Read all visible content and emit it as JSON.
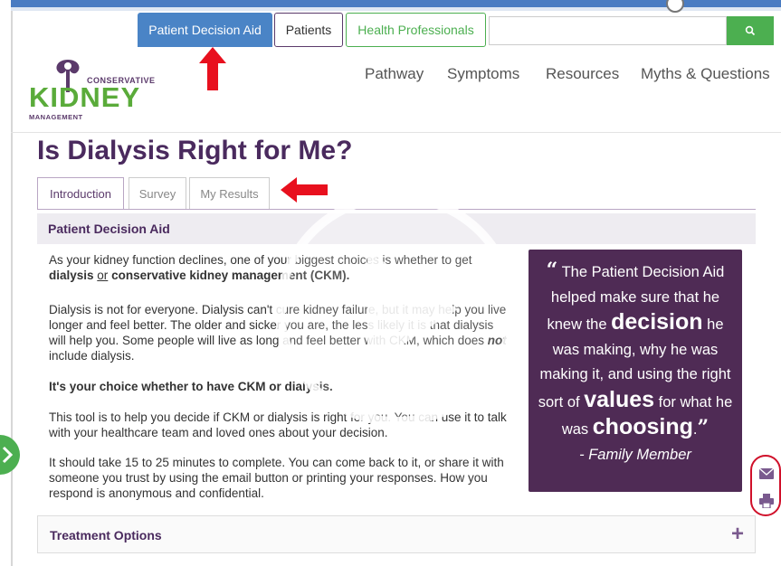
{
  "top_nav": {
    "patient_decision_aid": "Patient Decision Aid",
    "patients": "Patients",
    "health_professionals": "Health Professionals",
    "search_placeholder": ""
  },
  "logo": {
    "line1": "CONSERVATIVE",
    "kidney": "KIDNEY",
    "line3": "MANAGEMENT"
  },
  "main_nav": [
    "Pathway",
    "Symptoms",
    "Resources",
    "Myths & Questions"
  ],
  "page": {
    "title": "Is Dialysis Right for Me?",
    "tabs": [
      "Introduction",
      "Survey",
      "My Results"
    ],
    "section_heading": "Patient Decision Aid",
    "para1_a": "As your kidney function declines, one of your biggest choices is whether to get ",
    "para1_b": "dialysis",
    "para1_c": "or",
    "para1_d": "conservative kidney management (CKM).",
    "para2_a": "Dialysis is not for everyone. Dialysis can't cure kidney failure, but it may help you live longer and feel better. The older and sicker you are, the less likely it is that dialysis will help you. Some people will live as long and feel better with CKM, which does ",
    "para2_b": "not",
    "para2_c": " include dialysis.",
    "para3": "It's your choice whether to have CKM or dialysis.",
    "para4": "This tool is to help you decide if CKM or dialysis is right for you. You can use it to talk with your healthcare team and loved ones about your decision.",
    "para5": "It should take 15 to 25 minutes to complete.  You can come back to it, or share it with someone you trust by using the email button or printing your responses. How you respond is anonymous and confidential.",
    "treatment_options": "Treatment Options",
    "plus": "+"
  },
  "quote": {
    "open_mark": "“",
    "t1": "The Patient Decision Aid helped make sure that he knew the",
    "decision": "decision",
    "t2": "he was making, why he was making it, and using the right sort of",
    "values": "values",
    "t3": "for what he was",
    "choosing": "choosing",
    "t4": ".",
    "close_mark": "”",
    "attribution": "- Family Member"
  },
  "icons": [
    "search-icon",
    "email-icon",
    "print-icon",
    "play-icon"
  ],
  "colors": {
    "brand_purple": "#4f2b55",
    "brand_green": "#4caf50",
    "nav_blue": "#4a84c6",
    "annotation_red": "#d0102a"
  }
}
